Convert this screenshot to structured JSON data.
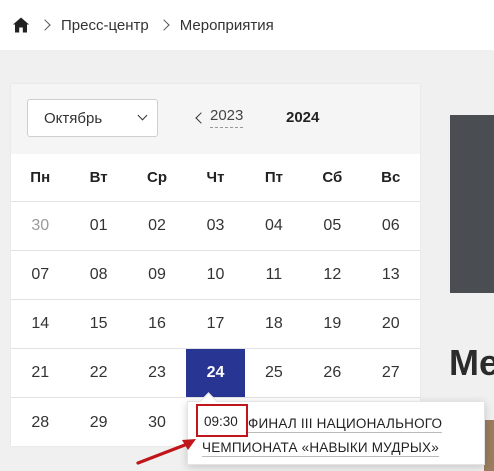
{
  "breadcrumb": {
    "home_icon": "home-icon",
    "items": [
      "Пресс-центр",
      "Мероприятия"
    ]
  },
  "calendar": {
    "month_select": "Октябрь",
    "year_prev": "2023",
    "year_current": "2024",
    "weekdays": [
      "Пн",
      "Вт",
      "Ср",
      "Чт",
      "Пт",
      "Сб",
      "Вс"
    ],
    "weeks": [
      [
        "30",
        "01",
        "02",
        "03",
        "04",
        "05",
        "06"
      ],
      [
        "07",
        "08",
        "09",
        "10",
        "11",
        "12",
        "13"
      ],
      [
        "14",
        "15",
        "16",
        "17",
        "18",
        "19",
        "20"
      ],
      [
        "21",
        "22",
        "23",
        "24",
        "25",
        "26",
        "27"
      ],
      [
        "28",
        "29",
        "30",
        "",
        "",
        "",
        ""
      ]
    ],
    "other_month_days": [
      "30"
    ],
    "selected_day": "24"
  },
  "popover": {
    "time": "09:30",
    "title": "ФИНАЛ III НАЦИОНАЛЬНОГО ЧЕМПИОНАТА «НАВЫКИ МУДРЫХ»"
  },
  "right_heading": "Ме",
  "colors": {
    "selected_day": "#283593",
    "annotation": "#c0161b",
    "panel": "#4a4e53"
  }
}
